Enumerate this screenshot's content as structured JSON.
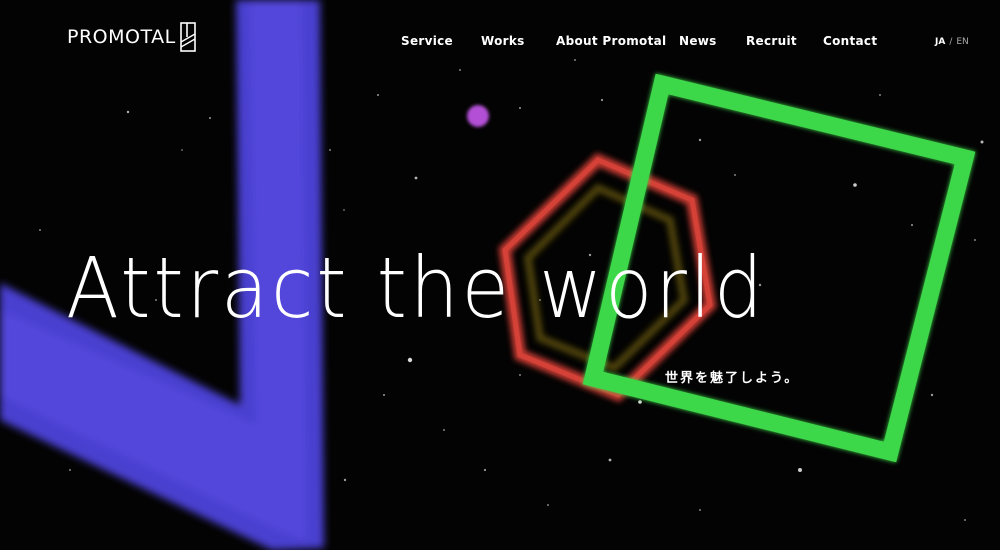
{
  "header": {
    "logo_text": "PROMOTAL",
    "logo_mark_icon": "promotal-mark-icon",
    "nav": [
      {
        "label": "Service"
      },
      {
        "label": "Works"
      },
      {
        "label": "About Promotal"
      },
      {
        "label": "News"
      },
      {
        "label": "Recruit"
      },
      {
        "label": "Contact"
      }
    ],
    "lang": {
      "ja": "JA",
      "separator": "/",
      "en": "EN"
    }
  },
  "hero": {
    "headline": "Attract the world",
    "subheadline": "世界を魅了しよう。"
  },
  "colors": {
    "background": "#030303",
    "blue_shape": "#4a3fd0",
    "green_shape": "#3ed84a",
    "red_shape": "#e8443a",
    "magenta_dot": "#b24fd6",
    "text": "#ffffff"
  }
}
